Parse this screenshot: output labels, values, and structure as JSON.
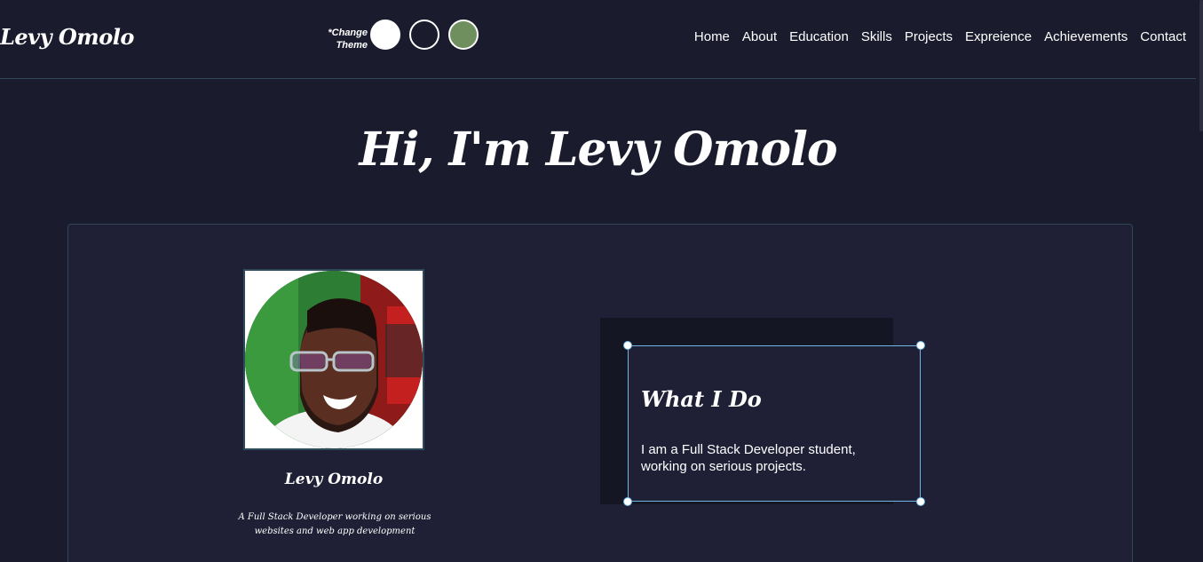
{
  "header": {
    "brand": "Levy Omolo",
    "theme_label": "*Change Theme",
    "theme_options": [
      {
        "name": "light",
        "color": "#ffffff"
      },
      {
        "name": "dark",
        "color": "#1a1b2d"
      },
      {
        "name": "green",
        "color": "#6f8f5e"
      }
    ],
    "nav": [
      "Home",
      "About",
      "Education",
      "Skills",
      "Projects",
      "Expreience",
      "Achievements",
      "Contact"
    ]
  },
  "hero": {
    "title": "Hi, I'm Levy Omolo"
  },
  "profile": {
    "name": "Levy Omolo",
    "tagline": "A Full Stack Developer working on serious websites and web app development"
  },
  "what_i_do": {
    "title": "What I Do",
    "text": "I am a Full Stack Developer student, working on serious projects."
  },
  "colors": {
    "background": "#1a1b2d",
    "card": "#1f2035",
    "border": "#30485a",
    "selection": "#6fb6e0"
  }
}
